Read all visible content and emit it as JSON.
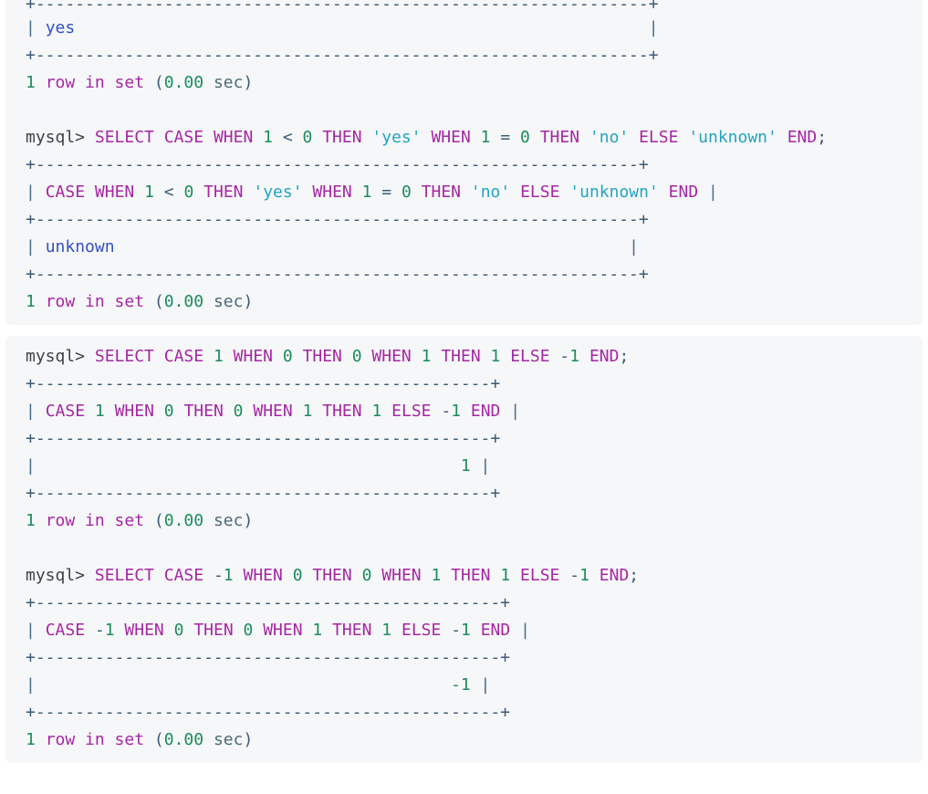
{
  "app": {
    "context": "mysql-client-terminal-transcript",
    "theme": {
      "page_background": "#ffffff",
      "block_background": "#f6f7f8",
      "keyword": "#a626a4",
      "string": "#21a5c4",
      "number": "#1c8c5c",
      "operator": "#3b5a78",
      "prompt": "#3d4247",
      "pipe": "#4a6b8a",
      "rule": "#3b5a78",
      "result_string": "#3250c8",
      "status": "#a626a4"
    }
  },
  "blocks": [
    {
      "id": "block-1",
      "clipped_at_top": true,
      "lines": [
        {
          "id": "b1-l1",
          "type": "rule",
          "kind": "table-rule-top-clipped",
          "text": "+--------------------------------------------------------------+"
        },
        {
          "id": "b1-l2",
          "type": "result-row",
          "pipe_left": "|",
          "value": "yes",
          "value_kind": "string",
          "pad": "                                                          ",
          "pipe_right": "|"
        },
        {
          "id": "b1-l3",
          "type": "rule",
          "kind": "table-rule-bottom",
          "text": "+--------------------------------------------------------------+"
        },
        {
          "id": "b1-l4",
          "type": "status",
          "count": "1",
          "words": "row in set",
          "open_paren": "(",
          "duration": "0.00",
          "unit": "sec",
          "close_paren": ")"
        },
        {
          "id": "b1-l5",
          "type": "blank"
        },
        {
          "id": "b1-l6",
          "type": "query",
          "prompt": "mysql>",
          "sql": "SELECT CASE WHEN 1 < 0 THEN 'yes' WHEN 1 = 0 THEN 'no' ELSE 'unknown' END;",
          "tokens": [
            {
              "t": "SELECT",
              "c": "kw"
            },
            {
              "t": " ",
              "c": "sp"
            },
            {
              "t": "CASE",
              "c": "kw"
            },
            {
              "t": " ",
              "c": "sp"
            },
            {
              "t": "WHEN",
              "c": "kw"
            },
            {
              "t": " ",
              "c": "sp"
            },
            {
              "t": "1",
              "c": "num"
            },
            {
              "t": " ",
              "c": "sp"
            },
            {
              "t": "<",
              "c": "op"
            },
            {
              "t": " ",
              "c": "sp"
            },
            {
              "t": "0",
              "c": "num"
            },
            {
              "t": " ",
              "c": "sp"
            },
            {
              "t": "THEN",
              "c": "kw"
            },
            {
              "t": " ",
              "c": "sp"
            },
            {
              "t": "'yes'",
              "c": "str"
            },
            {
              "t": " ",
              "c": "sp"
            },
            {
              "t": "WHEN",
              "c": "kw"
            },
            {
              "t": " ",
              "c": "sp"
            },
            {
              "t": "1",
              "c": "num"
            },
            {
              "t": " ",
              "c": "sp"
            },
            {
              "t": "=",
              "c": "op"
            },
            {
              "t": " ",
              "c": "sp"
            },
            {
              "t": "0",
              "c": "num"
            },
            {
              "t": " ",
              "c": "sp"
            },
            {
              "t": "THEN",
              "c": "kw"
            },
            {
              "t": " ",
              "c": "sp"
            },
            {
              "t": "'no'",
              "c": "str"
            },
            {
              "t": " ",
              "c": "sp"
            },
            {
              "t": "ELSE",
              "c": "kw"
            },
            {
              "t": " ",
              "c": "sp"
            },
            {
              "t": "'unknown'",
              "c": "str"
            },
            {
              "t": " ",
              "c": "sp"
            },
            {
              "t": "END",
              "c": "kw"
            },
            {
              "t": ";",
              "c": "op"
            }
          ]
        },
        {
          "id": "b1-l7",
          "type": "rule",
          "kind": "table-rule-top",
          "text": "+-------------------------------------------------------------+"
        },
        {
          "id": "b1-l8",
          "type": "header-row",
          "pipe_left": "|",
          "pipe_right": "|",
          "tokens": [
            {
              "t": "CASE",
              "c": "kw"
            },
            {
              "t": " ",
              "c": "sp"
            },
            {
              "t": "WHEN",
              "c": "kw"
            },
            {
              "t": " ",
              "c": "sp"
            },
            {
              "t": "1",
              "c": "num"
            },
            {
              "t": " ",
              "c": "sp"
            },
            {
              "t": "<",
              "c": "op"
            },
            {
              "t": " ",
              "c": "sp"
            },
            {
              "t": "0",
              "c": "num"
            },
            {
              "t": " ",
              "c": "sp"
            },
            {
              "t": "THEN",
              "c": "kw"
            },
            {
              "t": " ",
              "c": "sp"
            },
            {
              "t": "'yes'",
              "c": "str"
            },
            {
              "t": " ",
              "c": "sp"
            },
            {
              "t": "WHEN",
              "c": "kw"
            },
            {
              "t": " ",
              "c": "sp"
            },
            {
              "t": "1",
              "c": "num"
            },
            {
              "t": " ",
              "c": "sp"
            },
            {
              "t": "=",
              "c": "op"
            },
            {
              "t": " ",
              "c": "sp"
            },
            {
              "t": "0",
              "c": "num"
            },
            {
              "t": " ",
              "c": "sp"
            },
            {
              "t": "THEN",
              "c": "kw"
            },
            {
              "t": " ",
              "c": "sp"
            },
            {
              "t": "'no'",
              "c": "str"
            },
            {
              "t": " ",
              "c": "sp"
            },
            {
              "t": "ELSE",
              "c": "kw"
            },
            {
              "t": " ",
              "c": "sp"
            },
            {
              "t": "'unknown'",
              "c": "str"
            },
            {
              "t": " ",
              "c": "sp"
            },
            {
              "t": "END",
              "c": "kw"
            }
          ]
        },
        {
          "id": "b1-l9",
          "type": "rule",
          "kind": "table-rule-mid",
          "text": "+-------------------------------------------------------------+"
        },
        {
          "id": "b1-l10",
          "type": "result-row",
          "pipe_left": "|",
          "value": "unknown",
          "value_kind": "string",
          "pad": "                                                    ",
          "pipe_right": "|"
        },
        {
          "id": "b1-l11",
          "type": "rule",
          "kind": "table-rule-bottom",
          "text": "+-------------------------------------------------------------+"
        },
        {
          "id": "b1-l12",
          "type": "status",
          "count": "1",
          "words": "row in set",
          "open_paren": "(",
          "duration": "0.00",
          "unit": "sec",
          "close_paren": ")"
        }
      ]
    },
    {
      "id": "block-2",
      "clipped_at_top": false,
      "lines": [
        {
          "id": "b2-l1",
          "type": "query",
          "prompt": "mysql>",
          "sql": "SELECT CASE 1 WHEN 0 THEN 0 WHEN 1 THEN 1 ELSE -1 END;",
          "tokens": [
            {
              "t": "SELECT",
              "c": "kw"
            },
            {
              "t": " ",
              "c": "sp"
            },
            {
              "t": "CASE",
              "c": "kw"
            },
            {
              "t": " ",
              "c": "sp"
            },
            {
              "t": "1",
              "c": "num"
            },
            {
              "t": " ",
              "c": "sp"
            },
            {
              "t": "WHEN",
              "c": "kw"
            },
            {
              "t": " ",
              "c": "sp"
            },
            {
              "t": "0",
              "c": "num"
            },
            {
              "t": " ",
              "c": "sp"
            },
            {
              "t": "THEN",
              "c": "kw"
            },
            {
              "t": " ",
              "c": "sp"
            },
            {
              "t": "0",
              "c": "num"
            },
            {
              "t": " ",
              "c": "sp"
            },
            {
              "t": "WHEN",
              "c": "kw"
            },
            {
              "t": " ",
              "c": "sp"
            },
            {
              "t": "1",
              "c": "num"
            },
            {
              "t": " ",
              "c": "sp"
            },
            {
              "t": "THEN",
              "c": "kw"
            },
            {
              "t": " ",
              "c": "sp"
            },
            {
              "t": "1",
              "c": "num"
            },
            {
              "t": " ",
              "c": "sp"
            },
            {
              "t": "ELSE",
              "c": "kw"
            },
            {
              "t": " ",
              "c": "sp"
            },
            {
              "t": "-",
              "c": "op"
            },
            {
              "t": "1",
              "c": "num"
            },
            {
              "t": " ",
              "c": "sp"
            },
            {
              "t": "END",
              "c": "kw"
            },
            {
              "t": ";",
              "c": "op"
            }
          ]
        },
        {
          "id": "b2-l2",
          "type": "rule",
          "kind": "table-rule-top",
          "text": "+----------------------------------------------+"
        },
        {
          "id": "b2-l3",
          "type": "header-row",
          "pipe_left": "|",
          "pipe_right": "|",
          "tokens": [
            {
              "t": "CASE",
              "c": "kw"
            },
            {
              "t": " ",
              "c": "sp"
            },
            {
              "t": "1",
              "c": "num"
            },
            {
              "t": " ",
              "c": "sp"
            },
            {
              "t": "WHEN",
              "c": "kw"
            },
            {
              "t": " ",
              "c": "sp"
            },
            {
              "t": "0",
              "c": "num"
            },
            {
              "t": " ",
              "c": "sp"
            },
            {
              "t": "THEN",
              "c": "kw"
            },
            {
              "t": " ",
              "c": "sp"
            },
            {
              "t": "0",
              "c": "num"
            },
            {
              "t": " ",
              "c": "sp"
            },
            {
              "t": "WHEN",
              "c": "kw"
            },
            {
              "t": " ",
              "c": "sp"
            },
            {
              "t": "1",
              "c": "num"
            },
            {
              "t": " ",
              "c": "sp"
            },
            {
              "t": "THEN",
              "c": "kw"
            },
            {
              "t": " ",
              "c": "sp"
            },
            {
              "t": "1",
              "c": "num"
            },
            {
              "t": " ",
              "c": "sp"
            },
            {
              "t": "ELSE",
              "c": "kw"
            },
            {
              "t": " ",
              "c": "sp"
            },
            {
              "t": "-",
              "c": "op"
            },
            {
              "t": "1",
              "c": "num"
            },
            {
              "t": " ",
              "c": "sp"
            },
            {
              "t": "END",
              "c": "kw"
            }
          ]
        },
        {
          "id": "b2-l4",
          "type": "rule",
          "kind": "table-rule-mid",
          "text": "+----------------------------------------------+"
        },
        {
          "id": "b2-l5",
          "type": "result-row-num",
          "pipe_left": "|",
          "pad": "                                           ",
          "value": "1",
          "value_kind": "number",
          "pipe_right": "|"
        },
        {
          "id": "b2-l6",
          "type": "rule",
          "kind": "table-rule-bottom",
          "text": "+----------------------------------------------+"
        },
        {
          "id": "b2-l7",
          "type": "status",
          "count": "1",
          "words": "row in set",
          "open_paren": "(",
          "duration": "0.00",
          "unit": "sec",
          "close_paren": ")"
        },
        {
          "id": "b2-l8",
          "type": "blank"
        },
        {
          "id": "b2-l9",
          "type": "query",
          "prompt": "mysql>",
          "sql": "SELECT CASE -1 WHEN 0 THEN 0 WHEN 1 THEN 1 ELSE -1 END;",
          "tokens": [
            {
              "t": "SELECT",
              "c": "kw"
            },
            {
              "t": " ",
              "c": "sp"
            },
            {
              "t": "CASE",
              "c": "kw"
            },
            {
              "t": " ",
              "c": "sp"
            },
            {
              "t": "-",
              "c": "op"
            },
            {
              "t": "1",
              "c": "num"
            },
            {
              "t": " ",
              "c": "sp"
            },
            {
              "t": "WHEN",
              "c": "kw"
            },
            {
              "t": " ",
              "c": "sp"
            },
            {
              "t": "0",
              "c": "num"
            },
            {
              "t": " ",
              "c": "sp"
            },
            {
              "t": "THEN",
              "c": "kw"
            },
            {
              "t": " ",
              "c": "sp"
            },
            {
              "t": "0",
              "c": "num"
            },
            {
              "t": " ",
              "c": "sp"
            },
            {
              "t": "WHEN",
              "c": "kw"
            },
            {
              "t": " ",
              "c": "sp"
            },
            {
              "t": "1",
              "c": "num"
            },
            {
              "t": " ",
              "c": "sp"
            },
            {
              "t": "THEN",
              "c": "kw"
            },
            {
              "t": " ",
              "c": "sp"
            },
            {
              "t": "1",
              "c": "num"
            },
            {
              "t": " ",
              "c": "sp"
            },
            {
              "t": "ELSE",
              "c": "kw"
            },
            {
              "t": " ",
              "c": "sp"
            },
            {
              "t": "-",
              "c": "op"
            },
            {
              "t": "1",
              "c": "num"
            },
            {
              "t": " ",
              "c": "sp"
            },
            {
              "t": "END",
              "c": "kw"
            },
            {
              "t": ";",
              "c": "op"
            }
          ]
        },
        {
          "id": "b2-l10",
          "type": "rule",
          "kind": "table-rule-top",
          "text": "+-----------------------------------------------+"
        },
        {
          "id": "b2-l11",
          "type": "header-row",
          "pipe_left": "|",
          "pipe_right": "|",
          "tokens": [
            {
              "t": "CASE",
              "c": "kw"
            },
            {
              "t": " ",
              "c": "sp"
            },
            {
              "t": "-",
              "c": "op"
            },
            {
              "t": "1",
              "c": "num"
            },
            {
              "t": " ",
              "c": "sp"
            },
            {
              "t": "WHEN",
              "c": "kw"
            },
            {
              "t": " ",
              "c": "sp"
            },
            {
              "t": "0",
              "c": "num"
            },
            {
              "t": " ",
              "c": "sp"
            },
            {
              "t": "THEN",
              "c": "kw"
            },
            {
              "t": " ",
              "c": "sp"
            },
            {
              "t": "0",
              "c": "num"
            },
            {
              "t": " ",
              "c": "sp"
            },
            {
              "t": "WHEN",
              "c": "kw"
            },
            {
              "t": " ",
              "c": "sp"
            },
            {
              "t": "1",
              "c": "num"
            },
            {
              "t": " ",
              "c": "sp"
            },
            {
              "t": "THEN",
              "c": "kw"
            },
            {
              "t": " ",
              "c": "sp"
            },
            {
              "t": "1",
              "c": "num"
            },
            {
              "t": " ",
              "c": "sp"
            },
            {
              "t": "ELSE",
              "c": "kw"
            },
            {
              "t": " ",
              "c": "sp"
            },
            {
              "t": "-",
              "c": "op"
            },
            {
              "t": "1",
              "c": "num"
            },
            {
              "t": " ",
              "c": "sp"
            },
            {
              "t": "END",
              "c": "kw"
            }
          ]
        },
        {
          "id": "b2-l12",
          "type": "rule",
          "kind": "table-rule-mid",
          "text": "+-----------------------------------------------+"
        },
        {
          "id": "b2-l13",
          "type": "result-row-num",
          "pipe_left": "|",
          "pad": "                                          ",
          "value": "-1",
          "value_kind": "number",
          "pipe_right": "|"
        },
        {
          "id": "b2-l14",
          "type": "rule",
          "kind": "table-rule-bottom",
          "text": "+-----------------------------------------------+"
        },
        {
          "id": "b2-l15",
          "type": "status",
          "count": "1",
          "words": "row in set",
          "open_paren": "(",
          "duration": "0.00",
          "unit": "sec",
          "close_paren": ")"
        }
      ]
    }
  ]
}
